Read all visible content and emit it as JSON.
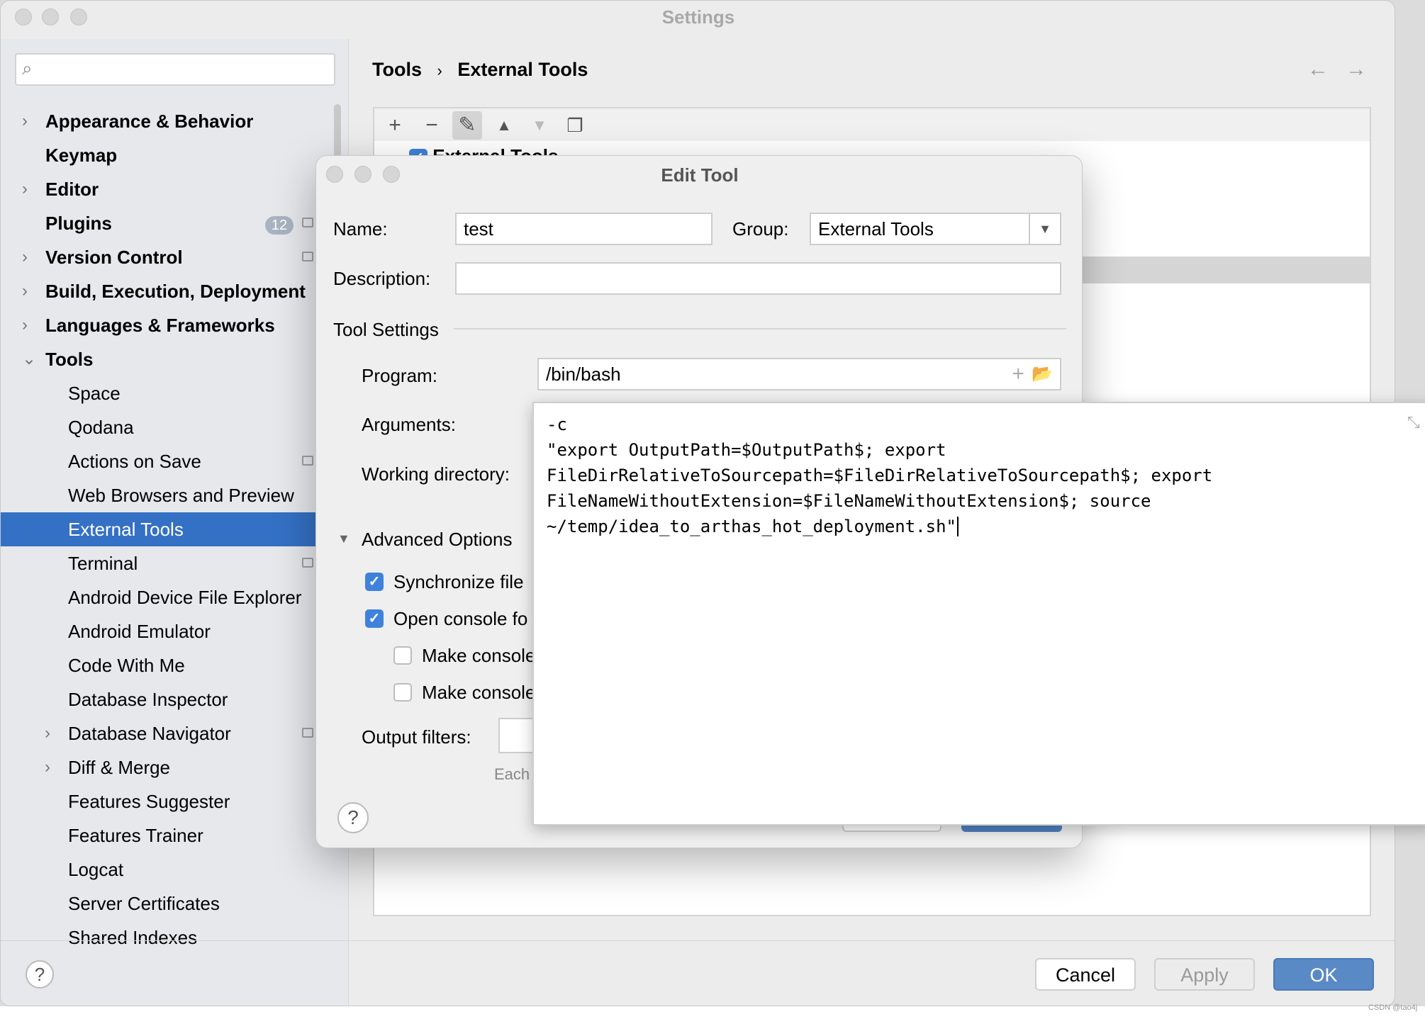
{
  "window": {
    "title": "Settings"
  },
  "sidebar": {
    "search_placeholder": "",
    "items": [
      {
        "label": "Appearance & Behavior",
        "level": 0,
        "expandable": true
      },
      {
        "label": "Keymap",
        "level": 0
      },
      {
        "label": "Editor",
        "level": 0,
        "expandable": true
      },
      {
        "label": "Plugins",
        "level": 0,
        "badge": "12"
      },
      {
        "label": "Version Control",
        "level": 0,
        "expandable": true
      },
      {
        "label": "Build, Execution, Deployment",
        "level": 0,
        "expandable": true
      },
      {
        "label": "Languages & Frameworks",
        "level": 0,
        "expandable": true
      },
      {
        "label": "Tools",
        "level": 0,
        "expanded": true
      },
      {
        "label": "Space",
        "level": 1
      },
      {
        "label": "Qodana",
        "level": 1
      },
      {
        "label": "Actions on Save",
        "level": 1
      },
      {
        "label": "Web Browsers and Preview",
        "level": 1
      },
      {
        "label": "External Tools",
        "level": 1,
        "selected": true
      },
      {
        "label": "Terminal",
        "level": 1
      },
      {
        "label": "Android Device File Explorer",
        "level": 1
      },
      {
        "label": "Android Emulator",
        "level": 1
      },
      {
        "label": "Code With Me",
        "level": 1
      },
      {
        "label": "Database Inspector",
        "level": 1
      },
      {
        "label": "Database Navigator",
        "level": 1,
        "expandable": true
      },
      {
        "label": "Diff & Merge",
        "level": 1,
        "expandable": true
      },
      {
        "label": "Features Suggester",
        "level": 1
      },
      {
        "label": "Features Trainer",
        "level": 1
      },
      {
        "label": "Logcat",
        "level": 1
      },
      {
        "label": "Server Certificates",
        "level": 1
      },
      {
        "label": "Shared Indexes",
        "level": 1
      }
    ]
  },
  "breadcrumb": {
    "parent": "Tools",
    "sep": "›",
    "current": "External Tools"
  },
  "list": {
    "group_label": "External Tools"
  },
  "footer": {
    "cancel": "Cancel",
    "apply": "Apply",
    "ok": "OK",
    "help": "?"
  },
  "dialog": {
    "title": "Edit Tool",
    "name_label": "Name:",
    "name_value": "test",
    "group_label": "Group:",
    "group_value": "External Tools",
    "description_label": "Description:",
    "description_value": "",
    "tool_settings": "Tool Settings",
    "program_label": "Program:",
    "program_value": "/bin/bash",
    "arguments_label": "Arguments:",
    "workdir_label": "Working directory:",
    "advanced": "Advanced Options",
    "sync_label": "Synchronize file",
    "sync_checked": true,
    "console_label": "Open console fo",
    "console_checked": true,
    "make1_label": "Make console",
    "make1_checked": false,
    "make2_label": "Make console",
    "make2_checked": false,
    "output_filters_label": "Output filters:",
    "hint": "Each",
    "help": "?"
  },
  "arguments_editor": {
    "lines": [
      "-c",
      "\"export OutputPath=$OutputPath$; export",
      "FileDirRelativeToSourcepath=$FileDirRelativeToSourcepath$; export",
      "FileNameWithoutExtension=$FileNameWithoutExtension$; source",
      "~/temp/idea_to_arthas_hot_deployment.sh\""
    ]
  },
  "watermark": "CSDN @tao4j",
  "colors": {
    "accent": "#3470c4",
    "checkbox": "#3f82dc",
    "ok_button": "#5a8ac6"
  }
}
